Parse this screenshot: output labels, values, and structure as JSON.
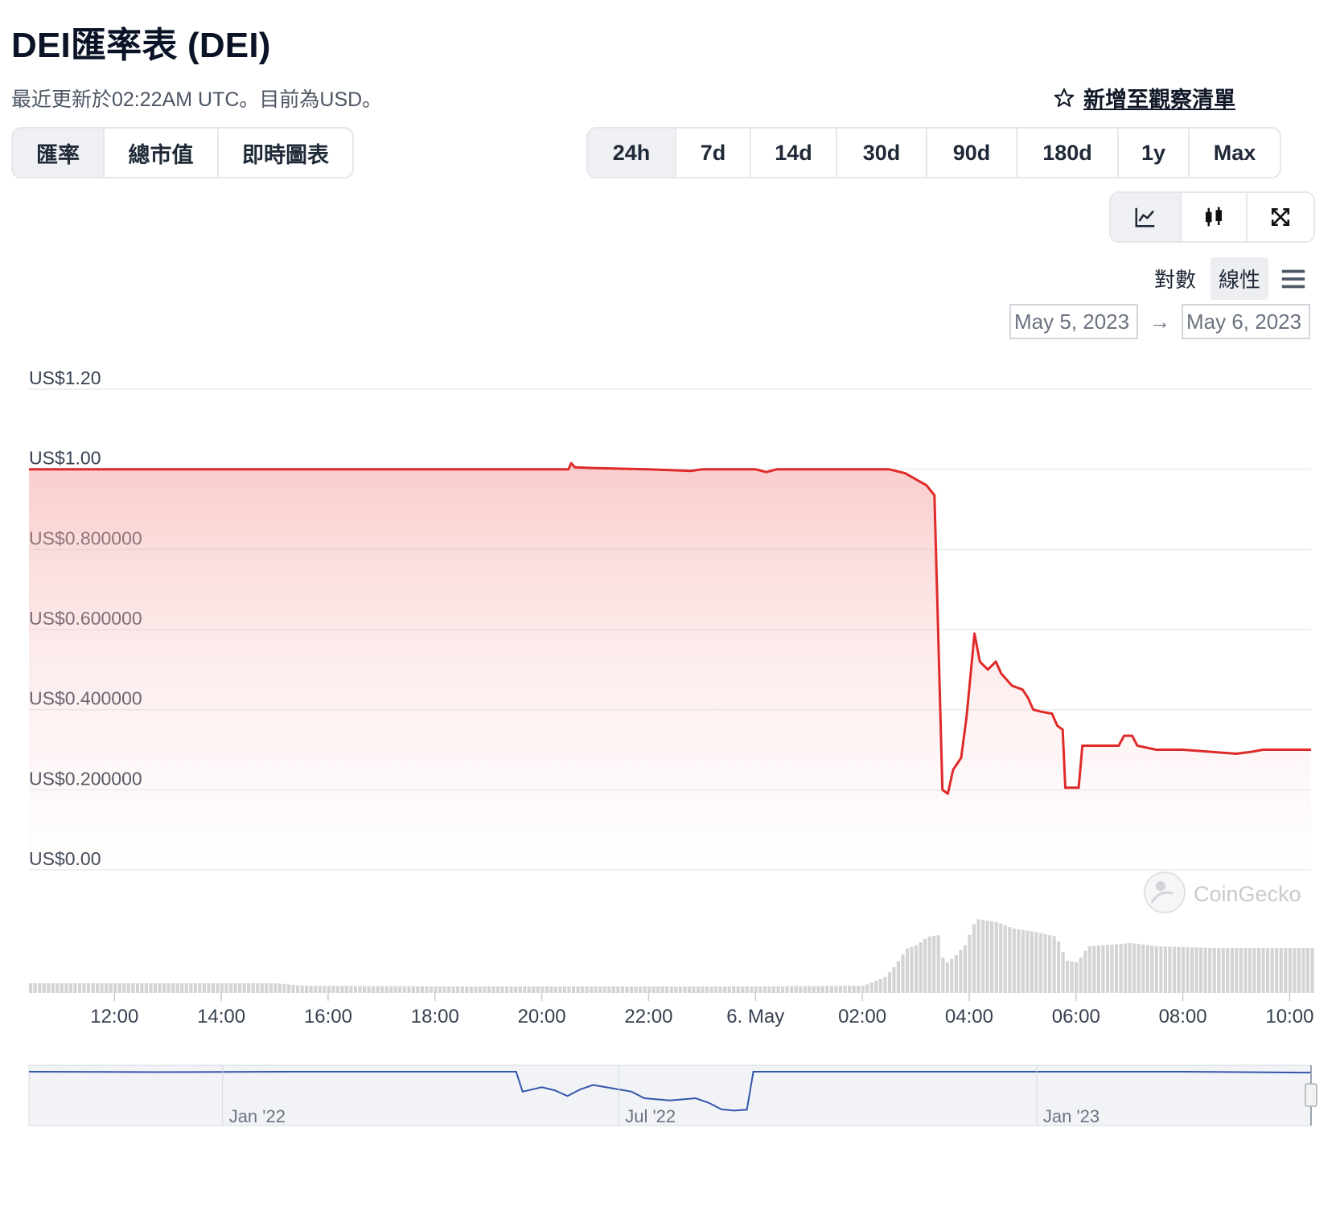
{
  "header": {
    "title": "DEI匯率表 (DEI)",
    "subtitle": "最近更新於02:22AM UTC。目前為USD。",
    "watchlist_label": "新增至觀察清單"
  },
  "tabs": [
    {
      "label": "匯率",
      "active": true
    },
    {
      "label": "總市值",
      "active": false
    },
    {
      "label": "即時圖表",
      "active": false
    }
  ],
  "ranges": [
    {
      "label": "24h",
      "active": true
    },
    {
      "label": "7d",
      "active": false
    },
    {
      "label": "14d",
      "active": false
    },
    {
      "label": "30d",
      "active": false
    },
    {
      "label": "90d",
      "active": false
    },
    {
      "label": "180d",
      "active": false
    },
    {
      "label": "1y",
      "active": false
    },
    {
      "label": "Max",
      "active": false
    }
  ],
  "view_buttons": [
    {
      "icon": "line-chart-icon",
      "active": true
    },
    {
      "icon": "candlestick-icon",
      "active": false
    },
    {
      "icon": "fullscreen-icon",
      "active": false
    }
  ],
  "scale": {
    "log_label": "對數",
    "linear_label": "線性",
    "active": "linear"
  },
  "date_range": {
    "from": "May 5, 2023",
    "to": "May 6, 2023",
    "arrow": "→"
  },
  "colors": {
    "price_line": "#e02a2a",
    "volume_bar": "#d4d4d4",
    "navigator_line": "#3355aa",
    "grid": "#e9ebee"
  },
  "watermark": "CoinGecko",
  "chart_data": {
    "type": "area",
    "y_ticks": [
      "US$1.20",
      "US$1.00",
      "US$0.800000",
      "US$0.600000",
      "US$0.400000",
      "US$0.200000",
      "US$0.00"
    ],
    "ylim": [
      0,
      1.2
    ],
    "x_ticks": [
      "12:00",
      "14:00",
      "16:00",
      "18:00",
      "20:00",
      "22:00",
      "6. May",
      "02:00",
      "04:00",
      "06:00",
      "08:00",
      "10:00"
    ],
    "x_unit": "hours",
    "xlim": [
      10.4,
      34.4
    ],
    "grid": true,
    "price": [
      [
        10.4,
        1.0
      ],
      [
        11.0,
        1.0
      ],
      [
        12.0,
        1.0
      ],
      [
        13.0,
        1.0
      ],
      [
        14.0,
        1.0
      ],
      [
        15.0,
        1.0
      ],
      [
        16.0,
        1.0
      ],
      [
        17.0,
        1.0
      ],
      [
        18.0,
        1.0
      ],
      [
        19.0,
        1.0
      ],
      [
        20.0,
        1.0
      ],
      [
        20.5,
        1.0
      ],
      [
        20.55,
        1.015
      ],
      [
        20.62,
        1.005
      ],
      [
        21.0,
        1.003
      ],
      [
        22.0,
        1.0
      ],
      [
        22.8,
        0.996
      ],
      [
        23.0,
        1.0
      ],
      [
        24.0,
        1.0
      ],
      [
        24.2,
        0.993
      ],
      [
        24.4,
        1.0
      ],
      [
        25.0,
        1.0
      ],
      [
        26.0,
        1.0
      ],
      [
        26.5,
        1.0
      ],
      [
        26.8,
        0.99
      ],
      [
        27.0,
        0.975
      ],
      [
        27.2,
        0.96
      ],
      [
        27.35,
        0.935
      ],
      [
        27.5,
        0.2
      ],
      [
        27.6,
        0.19
      ],
      [
        27.7,
        0.25
      ],
      [
        27.85,
        0.28
      ],
      [
        27.95,
        0.38
      ],
      [
        28.1,
        0.59
      ],
      [
        28.2,
        0.52
      ],
      [
        28.35,
        0.5
      ],
      [
        28.5,
        0.52
      ],
      [
        28.6,
        0.49
      ],
      [
        28.8,
        0.46
      ],
      [
        29.0,
        0.45
      ],
      [
        29.1,
        0.43
      ],
      [
        29.2,
        0.4
      ],
      [
        29.35,
        0.395
      ],
      [
        29.55,
        0.39
      ],
      [
        29.65,
        0.36
      ],
      [
        29.75,
        0.35
      ],
      [
        29.8,
        0.205
      ],
      [
        30.05,
        0.205
      ],
      [
        30.12,
        0.31
      ],
      [
        30.3,
        0.31
      ],
      [
        30.8,
        0.31
      ],
      [
        30.9,
        0.335
      ],
      [
        31.05,
        0.335
      ],
      [
        31.15,
        0.31
      ],
      [
        31.5,
        0.3
      ],
      [
        32.0,
        0.3
      ],
      [
        32.5,
        0.295
      ],
      [
        33.0,
        0.29
      ],
      [
        33.3,
        0.295
      ],
      [
        33.5,
        0.3
      ],
      [
        34.0,
        0.3
      ],
      [
        34.4,
        0.3
      ]
    ],
    "volume": [
      [
        10.4,
        0.12
      ],
      [
        12.0,
        0.12
      ],
      [
        14.0,
        0.12
      ],
      [
        15.0,
        0.12
      ],
      [
        15.5,
        0.09
      ],
      [
        18.0,
        0.08
      ],
      [
        20.0,
        0.08
      ],
      [
        22.0,
        0.08
      ],
      [
        24.0,
        0.08
      ],
      [
        26.0,
        0.09
      ],
      [
        26.4,
        0.2
      ],
      [
        26.6,
        0.35
      ],
      [
        26.8,
        0.55
      ],
      [
        27.0,
        0.6
      ],
      [
        27.2,
        0.7
      ],
      [
        27.4,
        0.72
      ],
      [
        27.5,
        0.35
      ],
      [
        27.7,
        0.45
      ],
      [
        27.9,
        0.6
      ],
      [
        28.1,
        0.92
      ],
      [
        28.5,
        0.88
      ],
      [
        28.8,
        0.8
      ],
      [
        29.2,
        0.76
      ],
      [
        29.6,
        0.7
      ],
      [
        29.8,
        0.4
      ],
      [
        30.0,
        0.38
      ],
      [
        30.2,
        0.58
      ],
      [
        31.0,
        0.62
      ],
      [
        31.5,
        0.58
      ],
      [
        32.5,
        0.56
      ],
      [
        33.5,
        0.56
      ],
      [
        34.4,
        0.56
      ]
    ],
    "navigator": {
      "x_labels": [
        "Jan '22",
        "Jul '22",
        "Jan '23"
      ],
      "series": [
        [
          0.0,
          1.0
        ],
        [
          0.1,
          0.99
        ],
        [
          0.2,
          1.0
        ],
        [
          0.3,
          1.0
        ],
        [
          0.38,
          1.0
        ],
        [
          0.385,
          0.55
        ],
        [
          0.4,
          0.65
        ],
        [
          0.41,
          0.58
        ],
        [
          0.42,
          0.45
        ],
        [
          0.43,
          0.6
        ],
        [
          0.44,
          0.7
        ],
        [
          0.46,
          0.6
        ],
        [
          0.47,
          0.55
        ],
        [
          0.48,
          0.4
        ],
        [
          0.5,
          0.35
        ],
        [
          0.52,
          0.4
        ],
        [
          0.53,
          0.3
        ],
        [
          0.54,
          0.15
        ],
        [
          0.55,
          0.12
        ],
        [
          0.56,
          0.14
        ],
        [
          0.565,
          1.0
        ],
        [
          0.7,
          1.0
        ],
        [
          0.8,
          1.0
        ],
        [
          0.9,
          1.0
        ],
        [
          0.995,
          0.98
        ],
        [
          1.0,
          0.98
        ]
      ]
    }
  }
}
